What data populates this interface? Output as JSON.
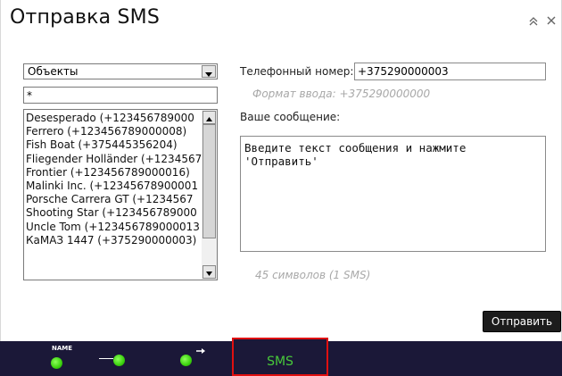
{
  "dialog": {
    "title": "Отправка SMS",
    "collapse_icon": "double-chevron-up-icon",
    "close_icon": "close-icon"
  },
  "objects": {
    "select_value": "Объекты",
    "filter_value": "*",
    "items": [
      "Desesperado (+123456789000",
      "Ferrero (+123456789000008)",
      "Fish Boat (+375445356204)",
      "Fliegender Holländer (+1234567",
      "Frontier (+123456789000016)",
      "Malinki Inc. (+12345678900001",
      "Porsche Carrera GT (+1234567",
      "Shooting Star (+123456789000",
      "Uncle Tom (+123456789000013",
      "КаМАЗ 1447 (+375290000003)"
    ]
  },
  "form": {
    "phone_label": "Телефонный номер:",
    "phone_value": "+375290000003",
    "phone_format": "Формат ввода: +375290000000",
    "message_label": "Ваше сообщение:",
    "message_value": "Введите текст сообщения и нажмите\n'Отправить'",
    "char_count": "45 символов (1 SMS)",
    "send_label": "Отправить"
  },
  "bottom_bar": {
    "name_tag": "NAME",
    "sms_tab": "SMS",
    "colors": {
      "bar": "#1b1838",
      "dot": "#3ad10d",
      "tab_highlight": "#e01010",
      "tab_text": "#48c93a"
    }
  }
}
